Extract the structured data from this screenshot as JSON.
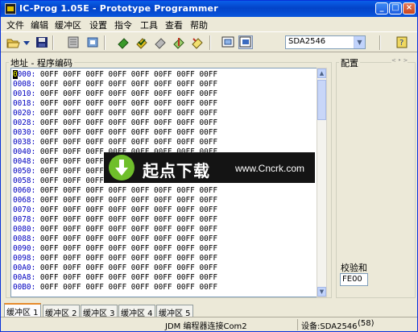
{
  "window": {
    "title": "IC-Prog 1.05E - Prototype Programmer",
    "min_label": "_",
    "max_label": "□",
    "close_label": "×"
  },
  "menu": [
    "文件",
    "编辑",
    "缓冲区",
    "设置",
    "指令",
    "工具",
    "查看",
    "帮助"
  ],
  "toolbar": {
    "icons": [
      "open-folder-icon",
      "dropdown-arrow-icon",
      "save-disk-icon",
      "read-chip-icon",
      "program-chip-icon",
      "erase-icon",
      "verify-icon",
      "blank-check-icon",
      "compare-icon",
      "hex-view-icon",
      "asm-view-icon",
      "help-icon"
    ],
    "device": "SDA2546"
  },
  "program_panel": {
    "label": "地址 - 程序编码",
    "rows": [
      {
        "addr": "0000:",
        "cells": "00FF 00FF 00FF 00FF 00FF 00FF 00FF 00FF"
      },
      {
        "addr": "0008:",
        "cells": "00FF 00FF 00FF 00FF 00FF 00FF 00FF 00FF"
      },
      {
        "addr": "0010:",
        "cells": "00FF 00FF 00FF 00FF 00FF 00FF 00FF 00FF"
      },
      {
        "addr": "0018:",
        "cells": "00FF 00FF 00FF 00FF 00FF 00FF 00FF 00FF"
      },
      {
        "addr": "0020:",
        "cells": "00FF 00FF 00FF 00FF 00FF 00FF 00FF 00FF"
      },
      {
        "addr": "0028:",
        "cells": "00FF 00FF 00FF 00FF 00FF 00FF 00FF 00FF"
      },
      {
        "addr": "0030:",
        "cells": "00FF 00FF 00FF 00FF 00FF 00FF 00FF 00FF"
      },
      {
        "addr": "0038:",
        "cells": "00FF 00FF 00FF 00FF 00FF 00FF 00FF 00FF"
      },
      {
        "addr": "0040:",
        "cells": "00FF 00FF 00FF 00FF 00FF 00FF 00FF 00FF"
      },
      {
        "addr": "0048:",
        "cells": "00FF 00FF 00FF 00FF 00FF 00FF 00FF 00FF"
      },
      {
        "addr": "0050:",
        "cells": "00FF 00FF 00FF 00FF 00FF 00FF 00FF 00FF"
      },
      {
        "addr": "0058:",
        "cells": "00FF 00FF 00FF 00FF 00FF 00FF 00FF 00FF"
      },
      {
        "addr": "0060:",
        "cells": "00FF 00FF 00FF 00FF 00FF 00FF 00FF 00FF"
      },
      {
        "addr": "0068:",
        "cells": "00FF 00FF 00FF 00FF 00FF 00FF 00FF 00FF"
      },
      {
        "addr": "0070:",
        "cells": "00FF 00FF 00FF 00FF 00FF 00FF 00FF 00FF"
      },
      {
        "addr": "0078:",
        "cells": "00FF 00FF 00FF 00FF 00FF 00FF 00FF 00FF"
      },
      {
        "addr": "0080:",
        "cells": "00FF 00FF 00FF 00FF 00FF 00FF 00FF 00FF"
      },
      {
        "addr": "0088:",
        "cells": "00FF 00FF 00FF 00FF 00FF 00FF 00FF 00FF"
      },
      {
        "addr": "0090:",
        "cells": "00FF 00FF 00FF 00FF 00FF 00FF 00FF 00FF"
      },
      {
        "addr": "0098:",
        "cells": "00FF 00FF 00FF 00FF 00FF 00FF 00FF 00FF"
      },
      {
        "addr": "00A0:",
        "cells": "00FF 00FF 00FF 00FF 00FF 00FF 00FF 00FF"
      },
      {
        "addr": "00A8:",
        "cells": "00FF 00FF 00FF 00FF 00FF 00FF 00FF 00FF"
      },
      {
        "addr": "00B0:",
        "cells": "00FF 00FF 00FF 00FF 00FF 00FF 00FF 00FF"
      }
    ]
  },
  "watermark": {
    "brand": "起点下载",
    "url": "www.Cncrk.com"
  },
  "config_panel": {
    "label": "配置",
    "nav": "< ‣ >",
    "checksum_label": "校验和",
    "checksum_value": "FE00"
  },
  "tabs": [
    "缓冲区 1",
    "缓冲区 2",
    "缓冲区 3",
    "缓冲区 4",
    "缓冲区 5"
  ],
  "status": {
    "connection": "JDM 编程器连接Com2",
    "device": "设备:SDA2546",
    "device_count": "(58)"
  },
  "colors": {
    "title_bar": "#0a5ee8",
    "address_text": "#0000c0",
    "active_tab_accent": "#e68b2c",
    "watermark_green": "#6fbf2b"
  }
}
